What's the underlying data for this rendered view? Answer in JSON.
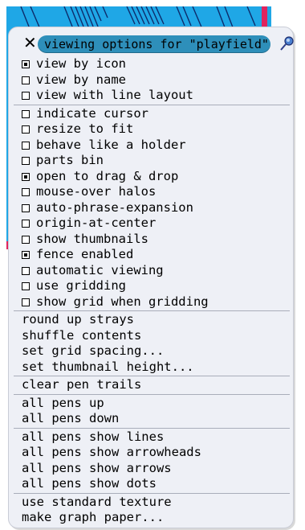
{
  "title": "viewing options for \"playfield\"",
  "groups": [
    [
      {
        "label": "view by icon",
        "checked": true
      },
      {
        "label": "view by name",
        "checked": false
      },
      {
        "label": "view with line layout",
        "checked": false
      }
    ],
    [
      {
        "label": "indicate cursor",
        "checked": false
      },
      {
        "label": "resize to fit",
        "checked": false
      },
      {
        "label": "behave like a holder",
        "checked": false
      },
      {
        "label": "parts bin",
        "checked": false
      },
      {
        "label": "open to drag & drop",
        "checked": true
      },
      {
        "label": "mouse-over halos",
        "checked": false
      },
      {
        "label": "auto-phrase-expansion",
        "checked": false
      },
      {
        "label": "origin-at-center",
        "checked": false
      },
      {
        "label": "show thumbnails",
        "checked": false
      },
      {
        "label": "fence enabled",
        "checked": true
      },
      {
        "label": "automatic viewing",
        "checked": false
      },
      {
        "label": "use gridding",
        "checked": false
      },
      {
        "label": "show grid when gridding",
        "checked": false
      }
    ],
    [
      {
        "label": "round up strays"
      },
      {
        "label": "shuffle contents"
      },
      {
        "label": "set grid spacing..."
      },
      {
        "label": "set thumbnail height..."
      }
    ],
    [
      {
        "label": "clear pen trails"
      }
    ],
    [
      {
        "label": "all pens up"
      },
      {
        "label": "all pens down"
      }
    ],
    [
      {
        "label": "all pens show lines"
      },
      {
        "label": "all pens show arrowheads"
      },
      {
        "label": "all pens show arrows"
      },
      {
        "label": "all pens show dots"
      }
    ],
    [
      {
        "label": "use standard texture"
      },
      {
        "label": "make graph paper..."
      }
    ]
  ],
  "icons": {
    "close": "close-icon",
    "pin": "pushpin-icon"
  }
}
